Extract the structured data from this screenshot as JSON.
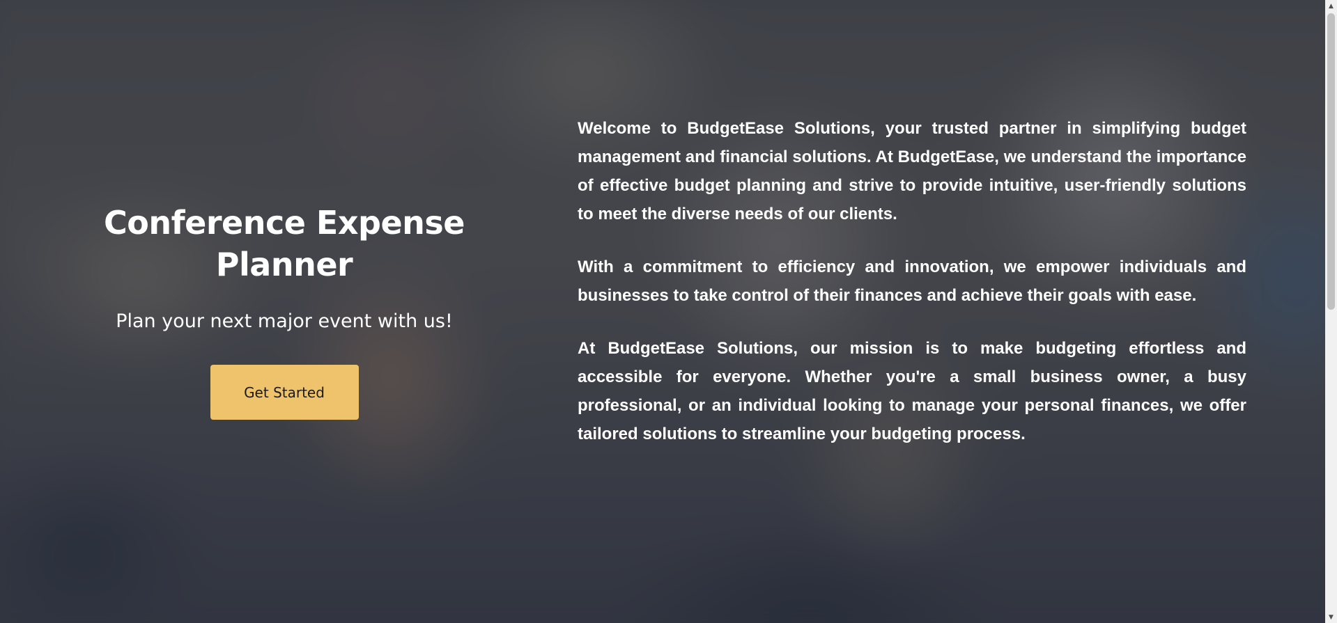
{
  "hero": {
    "title": "Conference Expense Planner",
    "subtitle": "Plan your next major event with us!",
    "cta_label": "Get Started",
    "cta_color": "#efc26c"
  },
  "about": {
    "paragraphs": [
      "Welcome to BudgetEase Solutions, your trusted partner in simplifying budget management and financial solutions. At BudgetEase, we understand the importance of effective budget planning and strive to provide intuitive, user-friendly solutions to meet the diverse needs of our clients.",
      "With a commitment to efficiency and innovation, we empower individuals and businesses to take control of their finances and achieve their goals with ease.",
      "At BudgetEase Solutions, our mission is to make budgeting effortless and accessible for everyone. Whether you're a small business owner, a busy professional, or an individual looking to manage your personal finances, we offer tailored solutions to streamline your budgeting process."
    ]
  },
  "scrollbar": {
    "up_icon": "arrow-up-icon",
    "down_icon": "arrow-down-icon"
  }
}
